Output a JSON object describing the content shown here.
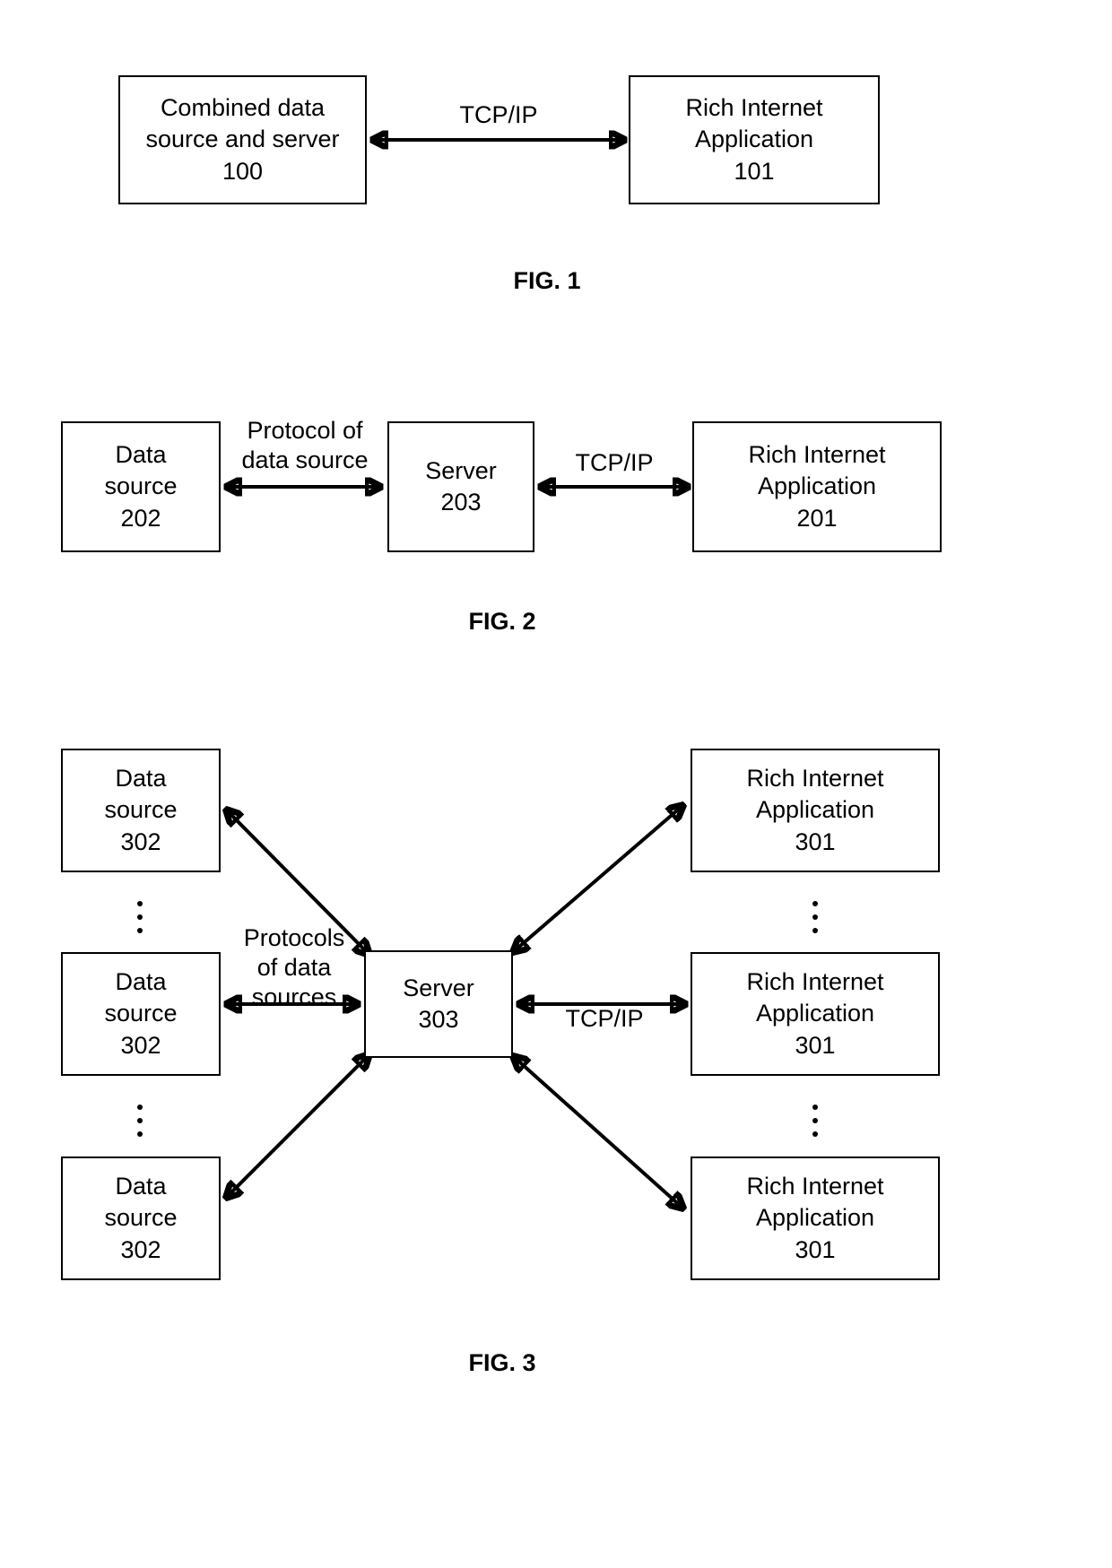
{
  "document": {
    "kind": "patent-figure-sheet",
    "figures": [
      "FIG. 1",
      "FIG. 2",
      "FIG. 3"
    ]
  },
  "fig1": {
    "caption": "FIG. 1",
    "nodes": {
      "combined": {
        "line1": "Combined data",
        "line2": "source and server",
        "line3": "100"
      },
      "ria": {
        "line1": "Rich Internet",
        "line2": "Application",
        "line3": "101"
      }
    },
    "edges": {
      "tcpip": {
        "label": "TCP/IP"
      }
    }
  },
  "fig2": {
    "caption": "FIG. 2",
    "nodes": {
      "data_source": {
        "line1": "Data",
        "line2": "source",
        "line3": "202"
      },
      "server": {
        "line1": "Server",
        "line2": "203"
      },
      "ria": {
        "line1": "Rich Internet",
        "line2": "Application",
        "line3": "201"
      }
    },
    "edges": {
      "protocol": {
        "line1": "Protocol of",
        "line2": "data source"
      },
      "tcpip": {
        "label": "TCP/IP"
      }
    }
  },
  "fig3": {
    "caption": "FIG. 3",
    "nodes": {
      "data_source_top": {
        "line1": "Data",
        "line2": "source",
        "line3": "302"
      },
      "data_source_mid": {
        "line1": "Data",
        "line2": "source",
        "line3": "302"
      },
      "data_source_bot": {
        "line1": "Data",
        "line2": "source",
        "line3": "302"
      },
      "server": {
        "line1": "Server",
        "line2": "303"
      },
      "ria_top": {
        "line1": "Rich Internet",
        "line2": "Application",
        "line3": "301"
      },
      "ria_mid": {
        "line1": "Rich Internet",
        "line2": "Application",
        "line3": "301"
      },
      "ria_bot": {
        "line1": "Rich Internet",
        "line2": "Application",
        "line3": "301"
      }
    },
    "edges": {
      "protocols": {
        "line1": "Protocols",
        "line2": "of data",
        "line3": "sources"
      },
      "tcpip": {
        "label": "TCP/IP"
      }
    },
    "ellipsis": {
      "glyph": "vertical-ellipsis",
      "count": 3
    }
  },
  "style": {
    "ink": "#000000",
    "paper": "#ffffff"
  }
}
